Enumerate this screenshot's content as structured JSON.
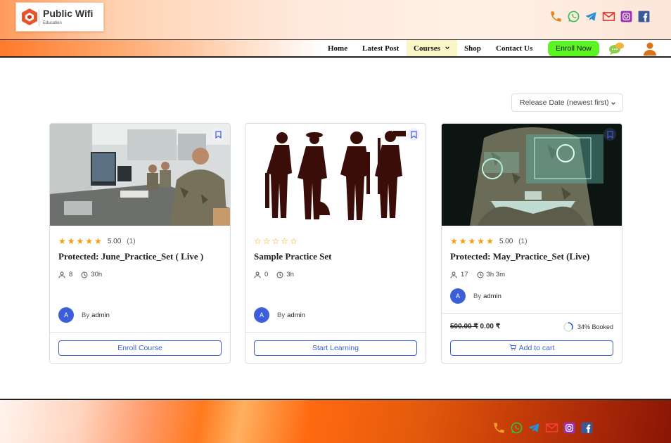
{
  "brand": {
    "name": "Public Wifi",
    "tagline": "Education"
  },
  "social": [
    "phone-icon",
    "whatsapp-icon",
    "telegram-icon",
    "mail-icon",
    "instagram-icon",
    "facebook-icon"
  ],
  "nav": {
    "home": "Home",
    "latest": "Latest Post",
    "courses": "Courses",
    "shop": "Shop",
    "contact": "Contact Us",
    "enroll": "Enroll Now"
  },
  "sort": {
    "label": "Release Date (newest first)"
  },
  "courses": [
    {
      "rating": "5.00",
      "rating_count": "(1)",
      "stars": 5,
      "title": "Protected: June_Practice_Set ( Live )",
      "students": "8",
      "duration": "30h",
      "avatar": "A",
      "by": "By",
      "author": "admin",
      "button": "Enroll Course"
    },
    {
      "rating": "",
      "rating_count": "",
      "stars": 0,
      "title": "Sample Practice Set",
      "students": "0",
      "duration": "3h",
      "avatar": "A",
      "by": "By",
      "author": "admin",
      "button": "Start Learning"
    },
    {
      "rating": "5.00",
      "rating_count": "(1)",
      "stars": 5,
      "title": "Protected: May_Practice_Set (Live)",
      "students": "17",
      "duration": "3h 3m",
      "avatar": "A",
      "by": "By",
      "author": "admin",
      "old_price": "500.00 ₹",
      "price": "0.00 ₹",
      "booked": "34% Booked",
      "booked_fraction": 0.34,
      "button": "Add to cart"
    }
  ],
  "colors": {
    "accent": "#3b5fd9",
    "star": "#f39c12",
    "enroll": "#5cf523"
  }
}
